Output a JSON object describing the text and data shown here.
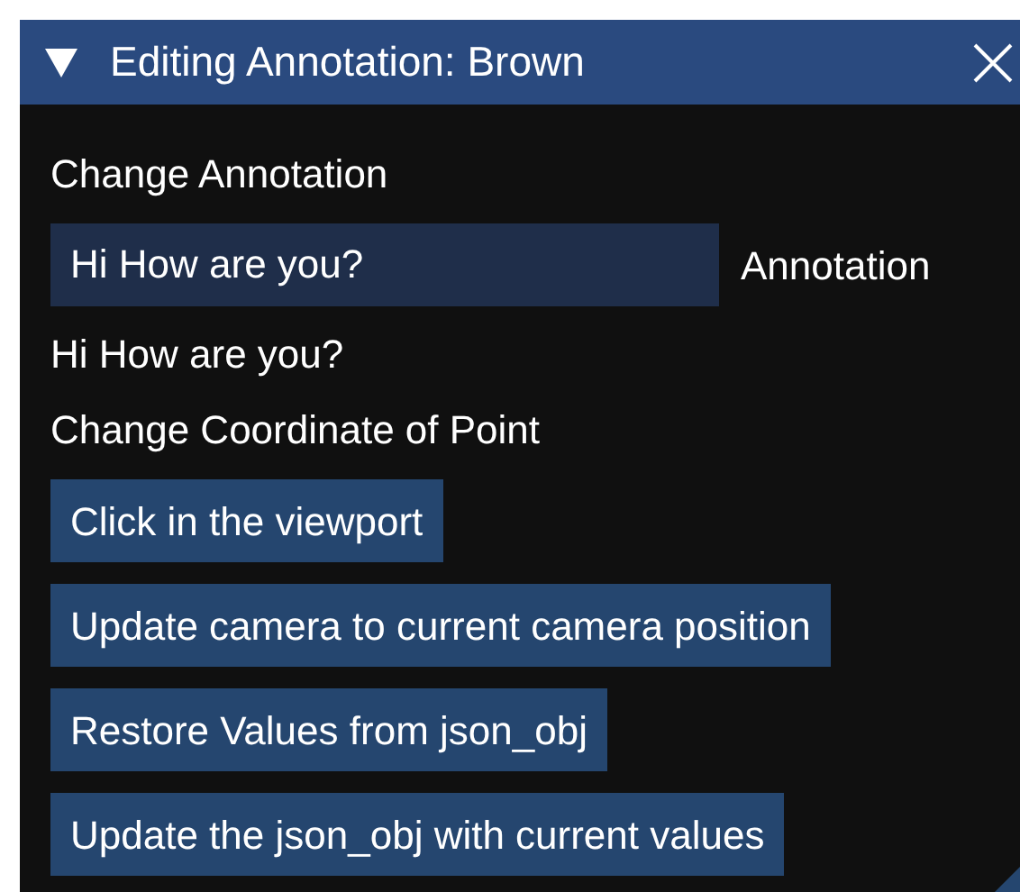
{
  "window": {
    "title": "Editing Annotation: Brown",
    "expanded": true
  },
  "items": [
    {
      "kind": "text",
      "text": "Change Annotation"
    },
    {
      "kind": "input",
      "value": "Hi How are you?",
      "label": "Annotation"
    },
    {
      "kind": "text",
      "text": "Hi How are you?"
    },
    {
      "kind": "text",
      "text": "Change Coordinate of Point"
    },
    {
      "kind": "button",
      "text": "Click in the viewport"
    },
    {
      "kind": "button",
      "text": "Update camera to current camera position"
    },
    {
      "kind": "button",
      "text": "Restore Values from json_obj"
    },
    {
      "kind": "button",
      "text": "Update the json_obj with current values"
    }
  ]
}
